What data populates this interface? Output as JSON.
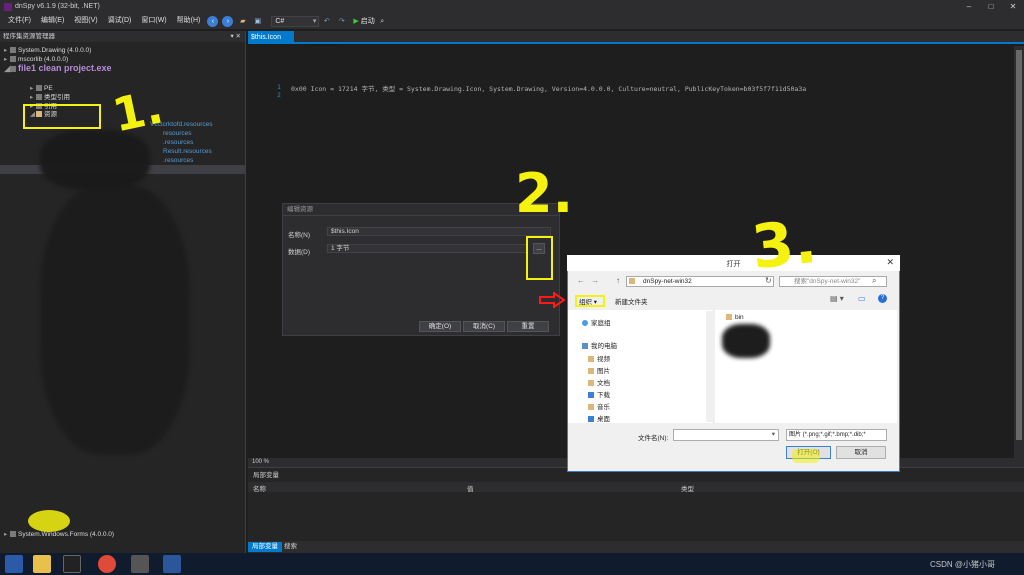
{
  "window": {
    "title": "dnSpy v6.1.9 (32-bit, .NET)",
    "controls": [
      "–",
      "□",
      "✕"
    ]
  },
  "menu": {
    "items": [
      "文件(F)",
      "编辑(E)",
      "视图(V)",
      "调试(D)",
      "窗口(W)",
      "帮助(H)"
    ],
    "language": "C#",
    "run_label": "启动"
  },
  "assembly_explorer": {
    "title": "程序集资源管理器",
    "rows": [
      {
        "text": "System.Drawing (4.0.0.0)",
        "kind": "assembly"
      },
      {
        "text": "mscorlib (4.0.0.0)",
        "kind": "assembly"
      },
      {
        "text": "file1 clean project.exe",
        "kind": "module"
      },
      {
        "text": "PE",
        "kind": "item"
      },
      {
        "text": "类型引用",
        "kind": "item"
      },
      {
        "text": "引用",
        "kind": "item"
      },
      {
        "text": "资源",
        "kind": "folder"
      },
      {
        "text": "VcGcrktofd.resources",
        "kind": "resource"
      },
      {
        "text": "resources",
        "kind": "resource"
      },
      {
        "text": ".resources",
        "kind": "resource"
      },
      {
        "text": "Result.resources",
        "kind": "resource"
      },
      {
        "text": ".resources",
        "kind": "resource"
      },
      {
        "text": "ad.resources",
        "kind": "resource"
      }
    ],
    "bottom_row": "System.Windows.Forms (4.0.0.0)"
  },
  "editor": {
    "tab_label": "$this.Icon",
    "line_numbers": [
      "1",
      "2"
    ],
    "code_line": "0x00       Icon = 17214 字节, 类型 = System.Drawing.Icon, System.Drawing, Version=4.0.0.0, Culture=neutral, PublicKeyToken=b03f5f7f11d50a3a"
  },
  "edit_resource_dialog": {
    "title": "编辑资源",
    "name_label": "名称(N)",
    "name_value": "$this.Icon",
    "data_label": "数据(D)",
    "data_value": "1 字节",
    "browse_label": "...",
    "ok_label": "确定(O)",
    "cancel_label": "取消(C)",
    "reset_label": "重置"
  },
  "open_dialog": {
    "title": "打开",
    "address": "dnSpy-net-win32",
    "search_placeholder": "搜索\"dnSpy-net-win32\"",
    "organize": "组织 ▾",
    "new_folder": "新建文件夹",
    "nav": {
      "homegroup": "家庭组",
      "this_pc": "我的电脑",
      "items": [
        "视频",
        "图片",
        "文档",
        "下载",
        "音乐",
        "桌面"
      ]
    },
    "files": [
      "bin"
    ],
    "filename_label": "文件名(N):",
    "filename_value": "",
    "filter_value": "图片 (*.png;*.gif;*.bmp;*.dib;*",
    "open_label": "打开(O)",
    "cancel_label": "取消"
  },
  "bottom_panel": {
    "title": "局部变量",
    "columns": [
      "名称",
      "值",
      "类型"
    ],
    "tabs": [
      "局部变量",
      "搜索"
    ]
  },
  "status": {
    "zoom": "100 %"
  },
  "annotations": {
    "step1": "1.",
    "step2": "2.",
    "step3": "3."
  },
  "watermark": "CSDN @小猪小哥"
}
